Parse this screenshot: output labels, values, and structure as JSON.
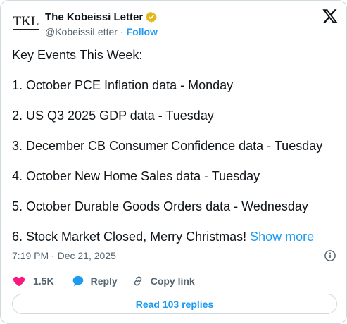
{
  "author": {
    "avatar_text": "TKL",
    "name": "The Kobeissi Letter",
    "handle": "@KobeissiLetter",
    "separator": "·",
    "follow_label": "Follow",
    "verified_badge_color": "#e2b719"
  },
  "tweet": {
    "lines": [
      "Key Events This Week:",
      "1. October PCE Inflation data - Monday",
      "2. US Q3 2025 GDP data - Tuesday",
      "3. December CB Consumer Confidence data - Tuesday",
      "4. October New Home Sales data - Tuesday",
      "5. October Durable Goods Orders data - Wednesday",
      "6. Stock Market Closed, Merry Christmas!"
    ],
    "show_more_label": "Show more",
    "timestamp": "7:19 PM · Dec 21, 2025"
  },
  "actions": {
    "likes_count": "1.5K",
    "reply_label": "Reply",
    "copy_link_label": "Copy link"
  },
  "read_replies_label": "Read 103 replies",
  "colors": {
    "accent": "#1d9bf0",
    "like": "#f91880",
    "secondary_text": "#536471",
    "border": "#cfd9de"
  },
  "icons": [
    "verified-badge-icon",
    "x-logo-icon",
    "info-icon",
    "heart-icon",
    "reply-bubble-icon",
    "link-icon"
  ]
}
